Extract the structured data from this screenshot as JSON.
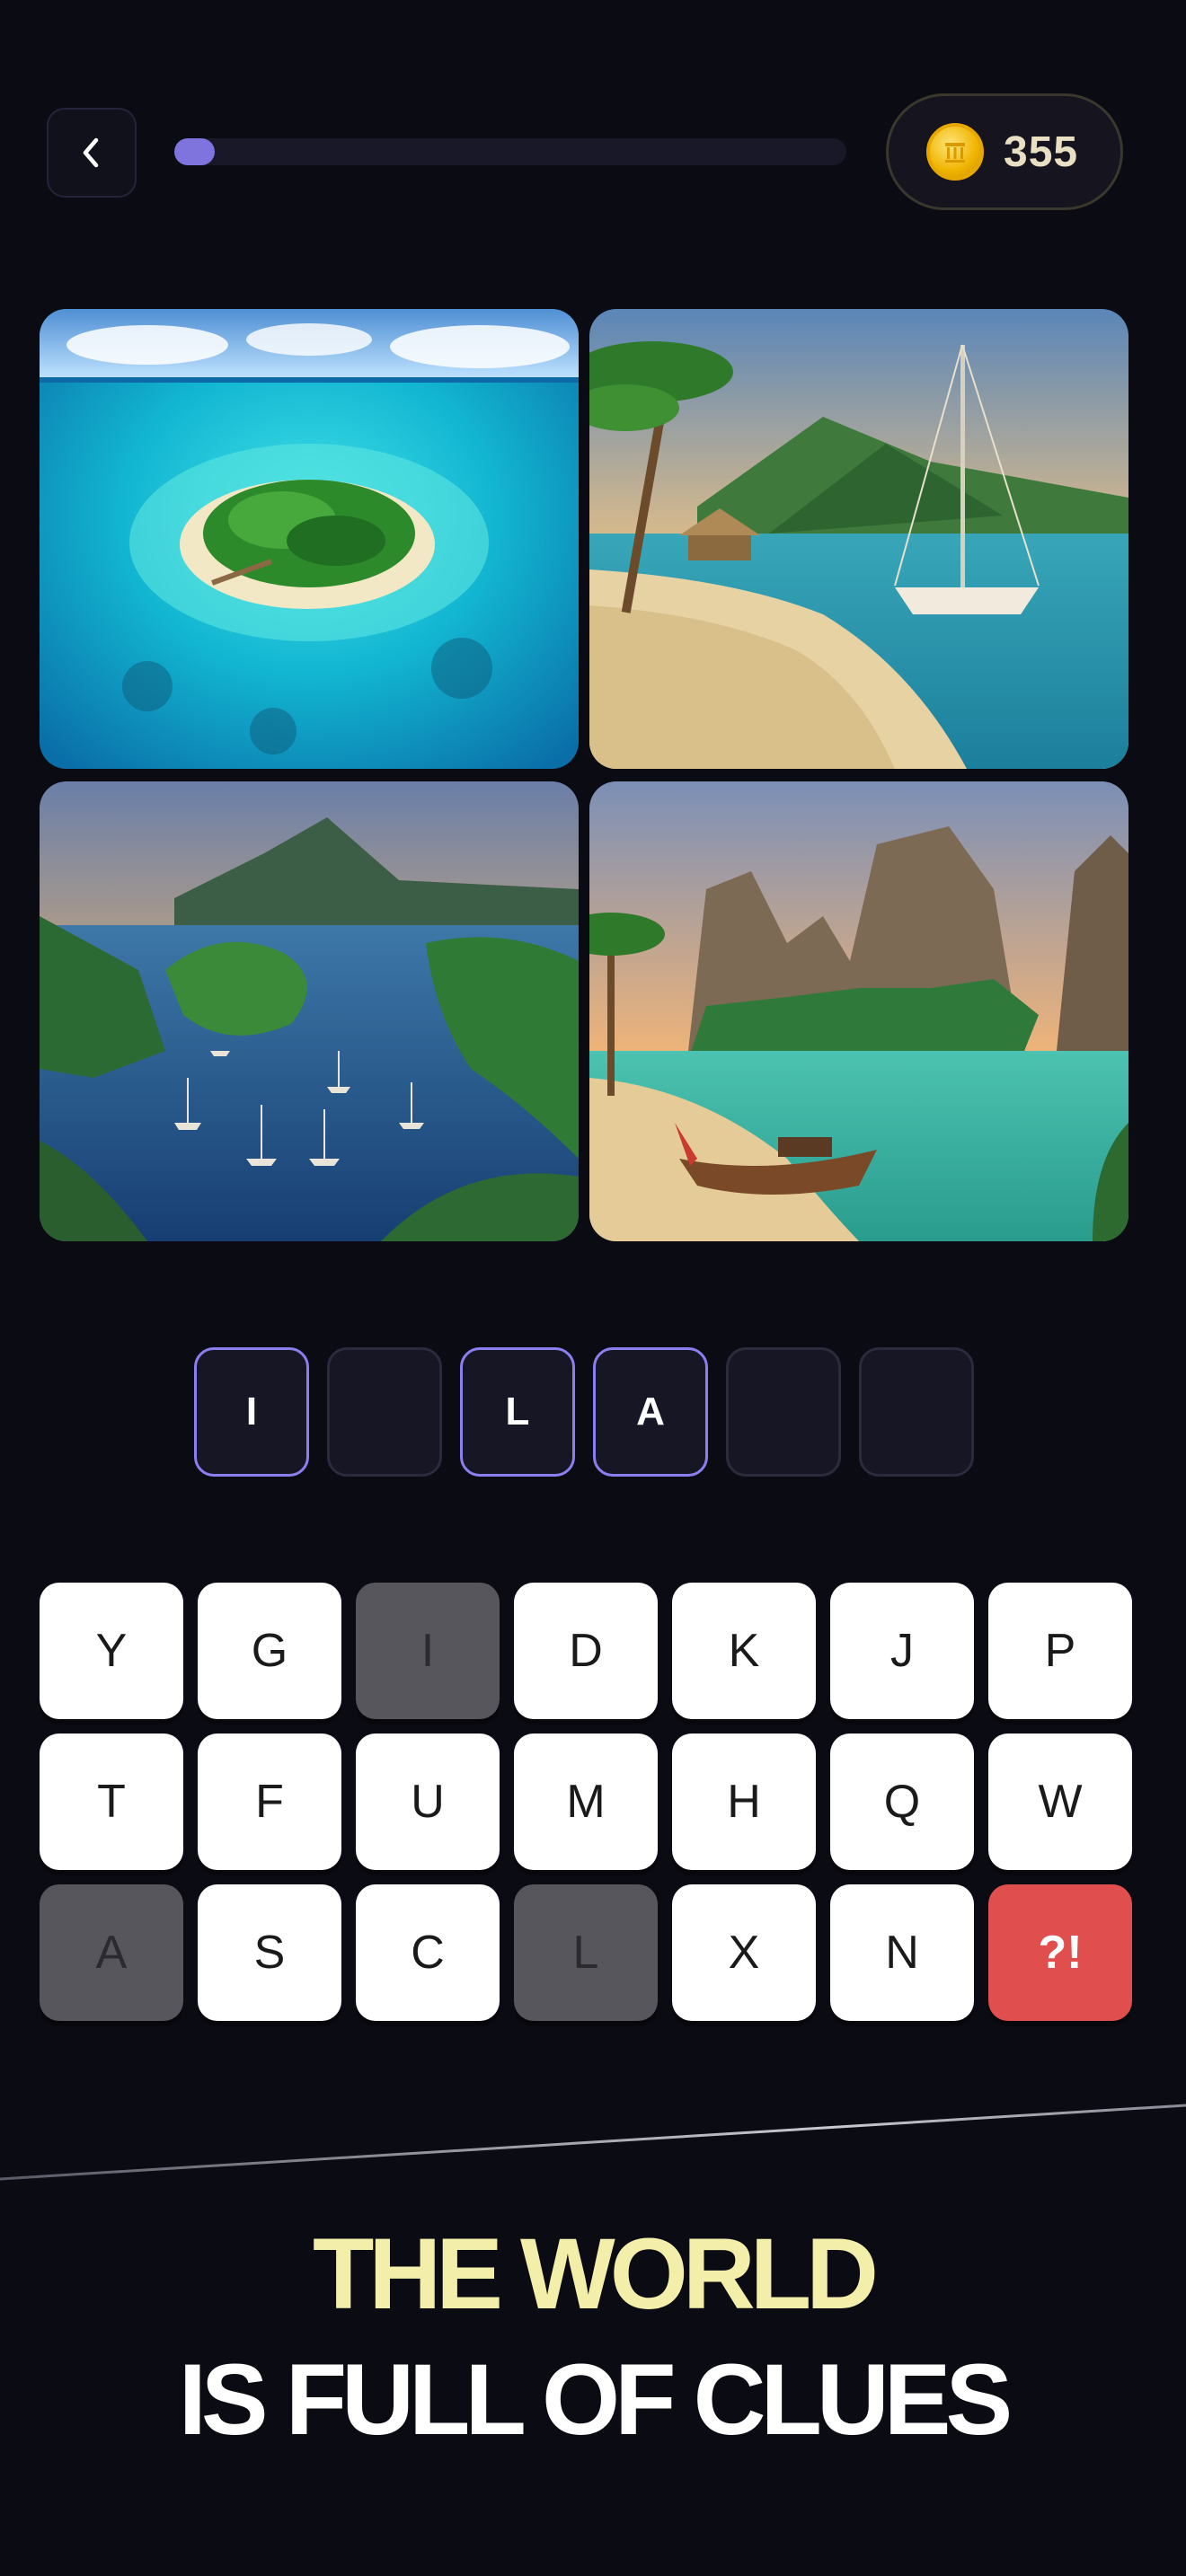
{
  "header": {
    "back_icon": "chevron-left-icon",
    "progress": 0.06,
    "coins": "355",
    "coin_icon": "gold-coin-icon"
  },
  "photos": [
    {
      "name": "tropical-island-aerial"
    },
    {
      "name": "palm-beach-sailboat"
    },
    {
      "name": "bay-with-boats"
    },
    {
      "name": "limestone-cliffs-longtail-boat"
    }
  ],
  "answer": {
    "slots": [
      "I",
      "",
      "L",
      "A",
      "",
      ""
    ]
  },
  "keyboard": {
    "keys": [
      {
        "label": "Y",
        "used": false
      },
      {
        "label": "G",
        "used": false
      },
      {
        "label": "I",
        "used": true
      },
      {
        "label": "D",
        "used": false
      },
      {
        "label": "K",
        "used": false
      },
      {
        "label": "J",
        "used": false
      },
      {
        "label": "P",
        "used": false
      },
      {
        "label": "T",
        "used": false
      },
      {
        "label": "F",
        "used": false
      },
      {
        "label": "U",
        "used": false
      },
      {
        "label": "M",
        "used": false
      },
      {
        "label": "H",
        "used": false
      },
      {
        "label": "Q",
        "used": false
      },
      {
        "label": "W",
        "used": false
      },
      {
        "label": "A",
        "used": true
      },
      {
        "label": "S",
        "used": false
      },
      {
        "label": "C",
        "used": false
      },
      {
        "label": "L",
        "used": true
      },
      {
        "label": "X",
        "used": false
      },
      {
        "label": "N",
        "used": false
      }
    ],
    "hint_label": "?!"
  },
  "tagline": {
    "line1": "THE WORLD",
    "line2": "IS FULL OF CLUES"
  },
  "colors": {
    "background": "#0b0b13",
    "accent": "#7f73dd",
    "tagline_highlight": "#f3efaa",
    "hint_key": "#e04e4e"
  }
}
